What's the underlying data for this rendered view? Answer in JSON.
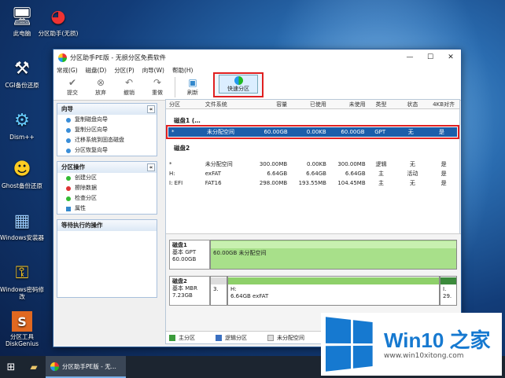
{
  "desktop": {
    "icons": [
      {
        "label": "此电脑",
        "glyph": "🖥"
      },
      {
        "label": "分区助手(无损)",
        "glyph": "◕"
      },
      {
        "label": "CGI备份还原",
        "glyph": "⚒"
      },
      {
        "label": "Dism++",
        "glyph": "⚙"
      },
      {
        "label": "Ghost备份还原",
        "glyph": "☻"
      },
      {
        "label": "Windows安装器",
        "glyph": "▦"
      },
      {
        "label": "Windows密码修改",
        "glyph": "⚿"
      },
      {
        "label": "分区工具DiskGenius",
        "glyph": "S"
      }
    ]
  },
  "window": {
    "title": "分区助手PE版 - 无损分区免费软件",
    "controls": {
      "minimize": "—",
      "maximize": "☐",
      "close": "✕"
    },
    "menu": [
      "常规(G)",
      "磁盘(D)",
      "分区(P)",
      "向导(W)",
      "帮助(H)"
    ],
    "toolbar": [
      {
        "label": "提交",
        "glyph": "✔"
      },
      {
        "label": "放弃",
        "glyph": "⊗"
      },
      {
        "label": "撤销",
        "glyph": "↶"
      },
      {
        "label": "重做",
        "glyph": "↷"
      },
      {
        "label": "刷新",
        "glyph": "▣"
      }
    ],
    "quick_partition": "快速分区"
  },
  "sidebar": {
    "wizard": {
      "title": "向导",
      "collapse": "«",
      "items": [
        "复制磁盘向导",
        "复制分区向导",
        "迁移系统到固态磁盘",
        "分区恢复向导"
      ]
    },
    "ops": {
      "title": "分区操作",
      "collapse": "«",
      "items": [
        "创建分区",
        "擦除数据",
        "检查分区",
        "属性"
      ]
    },
    "pending": {
      "title": "等待执行的操作"
    }
  },
  "table": {
    "headers": [
      "分区",
      "文件系统",
      "容量",
      "已使用",
      "未使用",
      "类型",
      "状态",
      "4KB对齐"
    ],
    "disk1": {
      "label": "磁盘1 (…",
      "rows": [
        [
          "*",
          "未分配空间",
          "60.00GB",
          "0.00KB",
          "60.00GB",
          "GPT",
          "无",
          "是"
        ]
      ]
    },
    "disk2": {
      "label": "磁盘2",
      "rows": [
        [
          "*",
          "未分配空间",
          "300.00MB",
          "0.00KB",
          "300.00MB",
          "逻辑",
          "无",
          "是"
        ],
        [
          "H:",
          "exFAT",
          "6.64GB",
          "6.64GB",
          "6.64GB",
          "主",
          "活动",
          "是"
        ],
        [
          "I: EFI",
          "FAT16",
          "298.00MB",
          "193.55MB",
          "104.45MB",
          "主",
          "无",
          "是"
        ]
      ]
    }
  },
  "diskmap": {
    "disk1": {
      "name": "磁盘1",
      "type": "基本 GPT",
      "size": "60.00GB",
      "seg": "60.00GB 未分配空间"
    },
    "disk2": {
      "name": "磁盘2",
      "type": "基本 MBR",
      "size": "7.23GB",
      "seg1_l1": "",
      "seg1_l2": "3.",
      "seg2_l1": "H:",
      "seg2_l2": "6.64GB exFAT",
      "seg3_l1": "I.",
      "seg3_l2": "29."
    }
  },
  "legend": {
    "primary": "主分区",
    "logical": "逻辑分区",
    "unalloc": "未分配空间"
  },
  "taskbar": {
    "app": "分区助手PE版 - 无..."
  },
  "brand": {
    "name": "Win10 之家",
    "url": "www.win10xitong.com"
  }
}
